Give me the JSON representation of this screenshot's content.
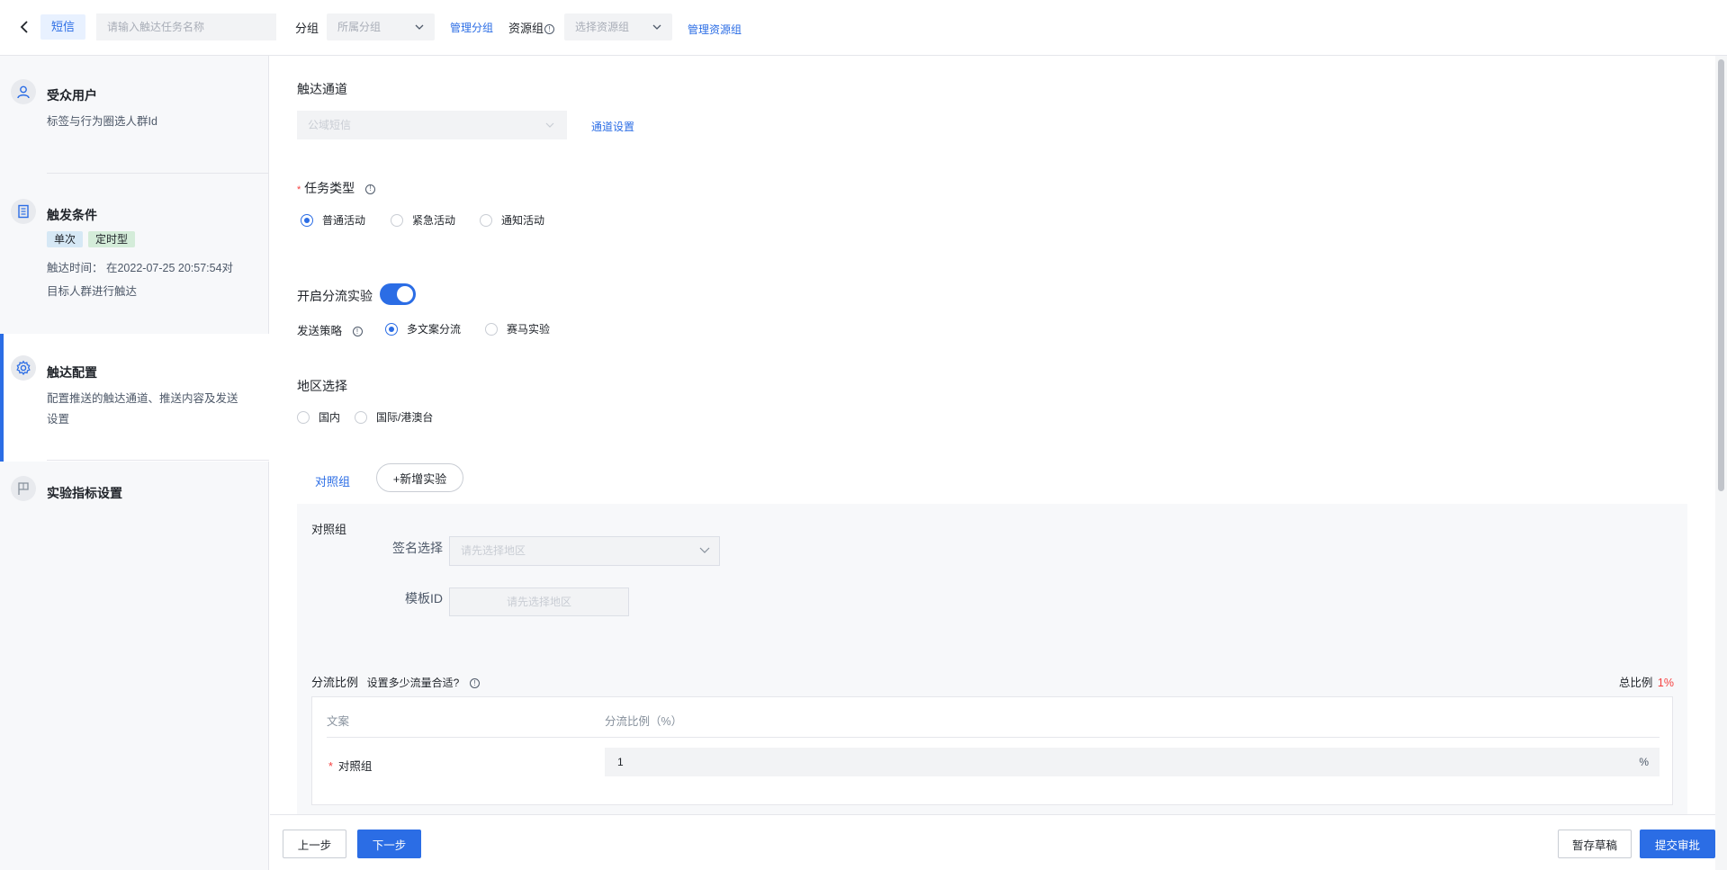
{
  "header": {
    "channel_tag": "短信",
    "task_name_placeholder": "请输入触达任务名称",
    "group_label": "分组",
    "group_select_placeholder": "所属分组",
    "manage_group_link": "管理分组",
    "resource_group_label": "资源组",
    "resource_select_placeholder": "选择资源组",
    "manage_resource_link": "管理资源组"
  },
  "sidebar": {
    "steps": [
      {
        "title": "受众用户",
        "desc": "标签与行为圈选人群Id"
      },
      {
        "title": "触发条件",
        "tags": [
          "单次",
          "定时型"
        ],
        "desc_line1": "触达时间：  在2022-07-25 20:57:54对",
        "desc_line2": "目标人群进行触达"
      },
      {
        "title": "触达配置",
        "desc_line1": "配置推送的触达通道、推送内容及发送",
        "desc_line2": "设置"
      },
      {
        "title": "实验指标设置"
      }
    ]
  },
  "main": {
    "channel_section": {
      "title": "触达通道",
      "select_value": "公域短信",
      "settings_link": "通道设置"
    },
    "task_type": {
      "required_mark": "*",
      "title": "任务类型",
      "options": [
        "普通活动",
        "紧急活动",
        "通知活动"
      ],
      "selected": "普通活动"
    },
    "split_experiment": {
      "label": "开启分流实验",
      "enabled": true
    },
    "send_strategy": {
      "label": "发送策略",
      "options": [
        "多文案分流",
        "赛马实验"
      ],
      "selected": "多文案分流"
    },
    "region": {
      "title": "地区选择",
      "options": [
        "国内",
        "国际/港澳台"
      ],
      "selected": ""
    },
    "groups": {
      "control_tab": "对照组",
      "add_experiment_button": "+新增实验"
    },
    "control_panel": {
      "title": "对照组",
      "signature_label": "签名选择",
      "signature_placeholder": "请先选择地区",
      "template_label": "模板ID",
      "template_placeholder": "请先选择地区"
    },
    "split_ratio": {
      "title": "分流比例",
      "hint": "设置多少流量合适?",
      "total_label": "总比例",
      "total_value": "1%",
      "col_copy": "文案",
      "col_ratio": "分流比例（%）",
      "row_required": "*",
      "row_name": "对照组",
      "row_value": "1",
      "row_unit": "%"
    }
  },
  "footer": {
    "prev_button": "上一步",
    "next_button": "下一步",
    "save_draft_button": "暂存草稿",
    "submit_button": "提交审批"
  },
  "colors": {
    "accent": "#2b6de5",
    "danger": "#f53f3f",
    "sidebar_bg": "#f7f8fa"
  }
}
